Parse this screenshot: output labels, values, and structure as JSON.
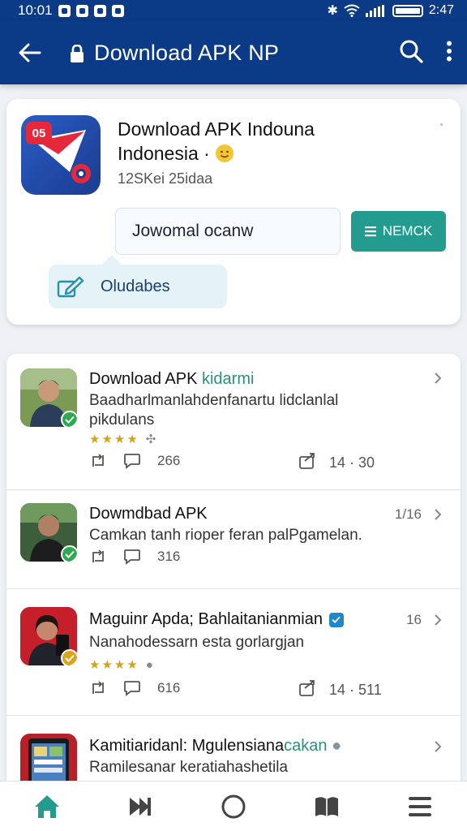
{
  "status_bar": {
    "time_left": "10:01",
    "time_right": "2:47"
  },
  "app_bar": {
    "title": "Download APK NP"
  },
  "app": {
    "badge": "05",
    "title_line1": "Download APK Indouna",
    "title_line2": "Indonesia ·",
    "meta": "12SKei 25idaa",
    "search_value": "Jowomal ocanw",
    "remick_label": "NEMCK",
    "bubble_label": "Oludabes"
  },
  "posts": [
    {
      "title": "Download APK ",
      "title_accent": "kidarmi",
      "text": "Baadharlmanlahdenfanartu lidclanlal pikdulans",
      "stars": "★★★★",
      "likes": "266",
      "shares": "14 · 30"
    },
    {
      "title": "Dowmdbad APK",
      "side": "1/16",
      "text": "Camkan tanh rioper feran palPgamelan.",
      "likes": "316"
    },
    {
      "title": "Maguinr Apda;  Bahlaitanianmian",
      "side": "16",
      "text": "Nanahodessarn esta gorlargjan",
      "stars": "★★★★",
      "likes": "616",
      "shares": "14 · 511"
    },
    {
      "title": "Kamitiaridanl: Mgulensiana",
      "title_accent": "cakan",
      "text": "Ramilesanar keratiahashetila"
    }
  ],
  "colors": {
    "header": "#0b3a86",
    "accent": "#239c8f",
    "star": "#d6a21c"
  }
}
